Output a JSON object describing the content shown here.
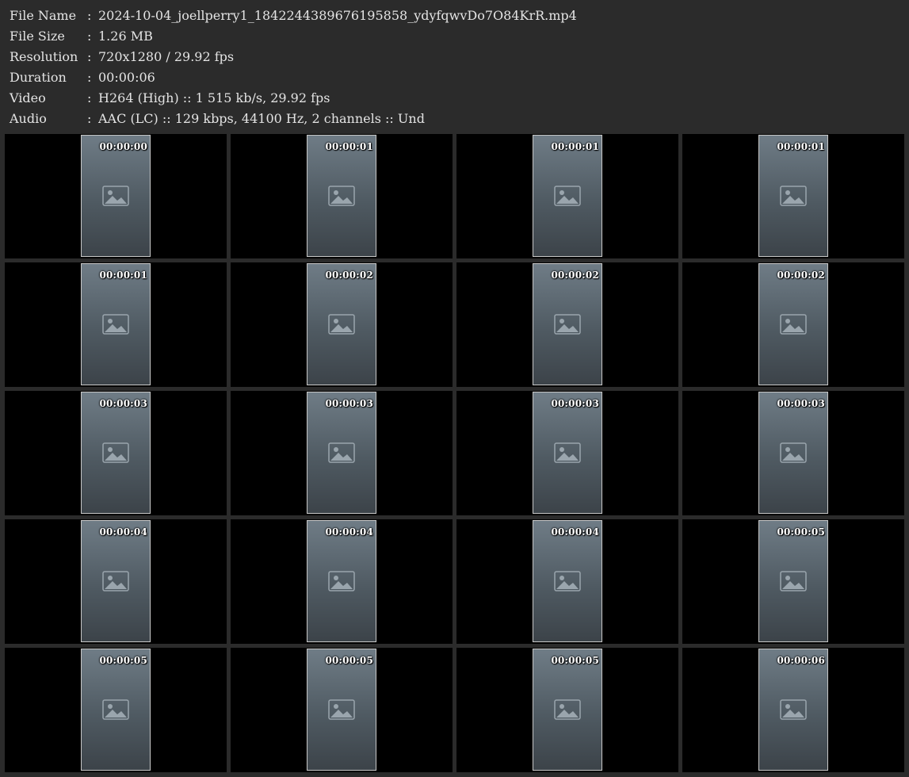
{
  "info": [
    {
      "label": "File Name",
      "sep": ":",
      "value": "2024-10-04_joellperry1_1842244389676195858_ydyfqwvDo7O84KrR.mp4"
    },
    {
      "label": "File Size",
      "sep": ":",
      "value": "1.26 MB"
    },
    {
      "label": "Resolution",
      "sep": ":",
      "value": "720x1280 / 29.92 fps"
    },
    {
      "label": "Duration",
      "sep": ":",
      "value": "00:00:06"
    },
    {
      "label": "Video",
      "sep": ":",
      "value": "H264 (High) :: 1 515 kb/s, 29.92 fps"
    },
    {
      "label": "Audio",
      "sep": ":",
      "value": "AAC (LC) :: 129 kbps, 44100 Hz, 2 channels :: Und"
    }
  ],
  "thumbnails": [
    {
      "time": "00:00:00"
    },
    {
      "time": "00:00:01"
    },
    {
      "time": "00:00:01"
    },
    {
      "time": "00:00:01"
    },
    {
      "time": "00:00:01"
    },
    {
      "time": "00:00:02"
    },
    {
      "time": "00:00:02"
    },
    {
      "time": "00:00:02"
    },
    {
      "time": "00:00:03"
    },
    {
      "time": "00:00:03"
    },
    {
      "time": "00:00:03"
    },
    {
      "time": "00:00:03"
    },
    {
      "time": "00:00:04"
    },
    {
      "time": "00:00:04"
    },
    {
      "time": "00:00:04"
    },
    {
      "time": "00:00:05"
    },
    {
      "time": "00:00:05"
    },
    {
      "time": "00:00:05"
    },
    {
      "time": "00:00:05"
    },
    {
      "time": "00:00:06"
    }
  ],
  "frame_icon": "image-placeholder-icon"
}
